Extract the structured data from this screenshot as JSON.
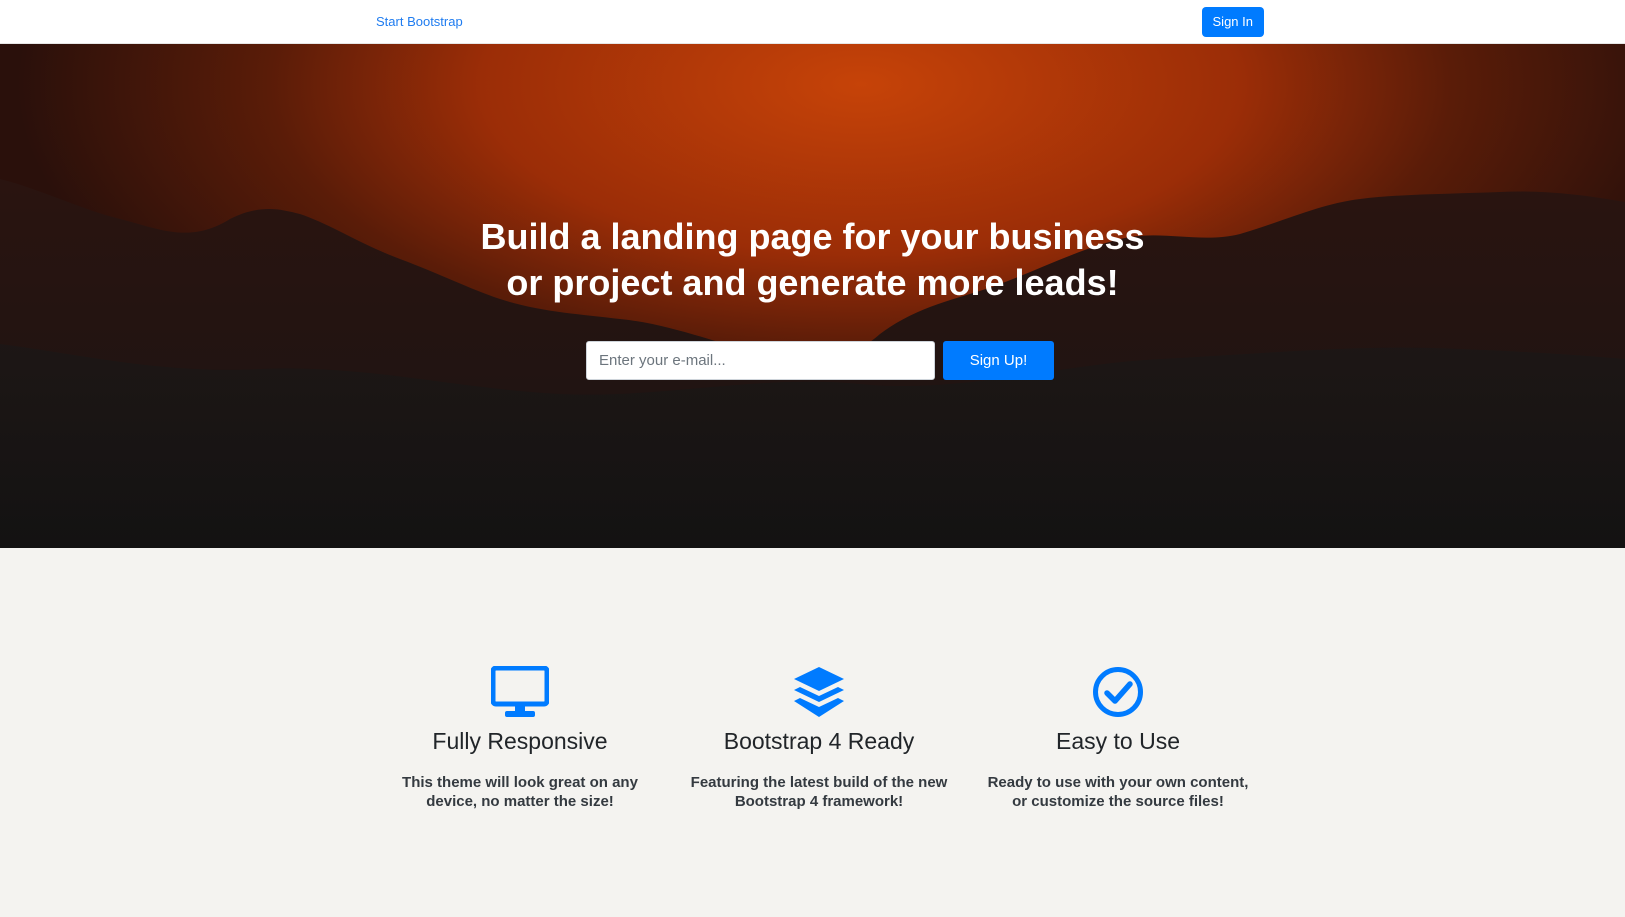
{
  "navbar": {
    "brand": "Start Bootstrap",
    "signin_label": "Sign In"
  },
  "hero": {
    "heading_line1": "Build a landing page for your business",
    "heading_line2": "or project and generate more leads!",
    "email_placeholder": "Enter your e-mail...",
    "email_value": "",
    "signup_label": "Sign Up!"
  },
  "features": [
    {
      "icon": "desktop-icon",
      "title": "Fully Responsive",
      "text": "This theme will look great on any device, no matter the size!"
    },
    {
      "icon": "layers-icon",
      "title": "Bootstrap 4 Ready",
      "text": "Featuring the latest build of the new Bootstrap 4 framework!"
    },
    {
      "icon": "check-circle-icon",
      "title": "Easy to Use",
      "text": "Ready to use with your own content, or customize the source files!"
    }
  ],
  "colors": {
    "accent": "#007bff",
    "hero_orange": "#c64308",
    "hero_dark": "#121212",
    "features_bg": "#f4f3f0"
  }
}
